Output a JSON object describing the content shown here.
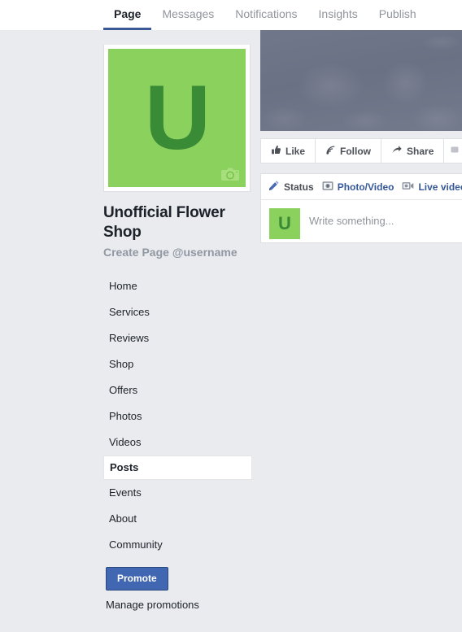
{
  "topnav": {
    "tabs": [
      {
        "label": "Page",
        "active": true
      },
      {
        "label": "Messages",
        "active": false
      },
      {
        "label": "Notifications",
        "active": false
      },
      {
        "label": "Insights",
        "active": false
      },
      {
        "label": "Publish",
        "active": false
      }
    ]
  },
  "profile": {
    "avatar_letter": "U",
    "avatar_bg": "#8bd15e",
    "avatar_fg": "#3a8b36",
    "page_name": "Unofficial Flower Shop",
    "username_line": "Create Page @username",
    "camera_icon": "camera-icon"
  },
  "sidebar": {
    "items": [
      {
        "label": "Home",
        "active": false
      },
      {
        "label": "Services",
        "active": false
      },
      {
        "label": "Reviews",
        "active": false
      },
      {
        "label": "Shop",
        "active": false
      },
      {
        "label": "Offers",
        "active": false
      },
      {
        "label": "Photos",
        "active": false
      },
      {
        "label": "Videos",
        "active": false
      },
      {
        "label": "Posts",
        "active": true
      },
      {
        "label": "Events",
        "active": false
      },
      {
        "label": "About",
        "active": false
      },
      {
        "label": "Community",
        "active": false
      }
    ],
    "promote_button": "Promote",
    "promote_color": "#4267b2",
    "manage_link": "Manage promotions"
  },
  "cover": {
    "alt": "cover-photo",
    "color": "#6e7588"
  },
  "actions": {
    "buttons": [
      {
        "label": "Like",
        "icon": "thumbs-up-icon"
      },
      {
        "label": "Follow",
        "icon": "rss-icon"
      },
      {
        "label": "Share",
        "icon": "share-arrow-icon"
      },
      {
        "label": "",
        "icon": "more-options-icon"
      }
    ]
  },
  "composer": {
    "tabs": [
      {
        "label": "Status",
        "icon": "pencil-icon",
        "style": "dark"
      },
      {
        "label": "Photo/Video",
        "icon": "photo-camera-icon",
        "style": "blue"
      },
      {
        "label": "Live video",
        "icon": "video-camera-icon",
        "style": "blue"
      }
    ],
    "avatar_letter": "U",
    "placeholder": "Write something..."
  }
}
